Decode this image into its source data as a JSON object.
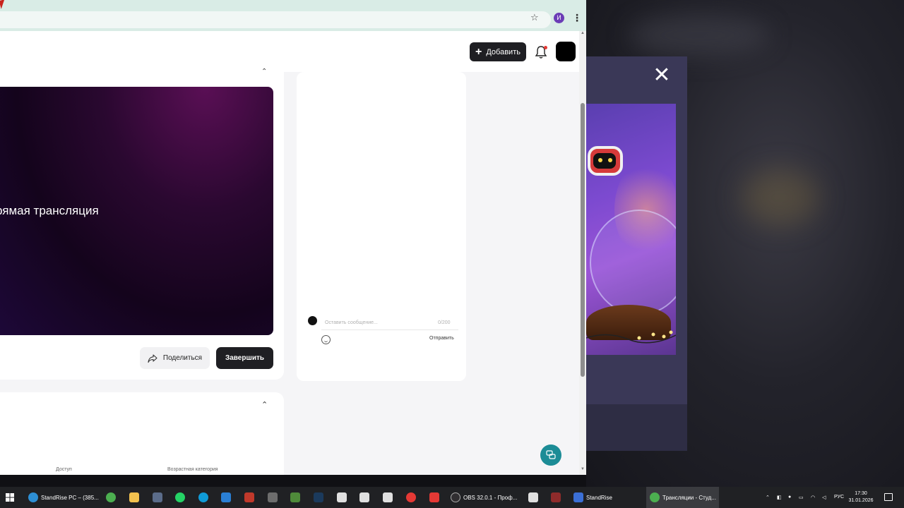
{
  "header": {
    "add_label": "Добавить"
  },
  "stream": {
    "title": "рямая трансляция",
    "share_label": "Поделиться",
    "finish_label": "Завершить"
  },
  "chat": {
    "placeholder": "Оставить сообщение...",
    "counter": "0/200",
    "send_label": "Отправить"
  },
  "settings": {
    "access_label": "Доступ",
    "age_label": "Возрастная категория"
  },
  "browser": {
    "profile_letter": "И"
  },
  "overlay": {
    "close_glyph": "✕"
  },
  "taskbar": {
    "items": [
      {
        "label": "StandRise PC – (385..."
      },
      {
        "label": "OBS 32.0.1 - Проф..."
      },
      {
        "label": "StandRise"
      },
      {
        "label": "Трансляции - Студ..."
      }
    ],
    "lang": "РУС",
    "time": "17:30",
    "date": "31.01.2026"
  },
  "colors": {
    "accent_dark": "#1f1f23",
    "support_teal": "#1c8c96",
    "notification_red": "#e53935"
  },
  "icons": [
    "star-icon",
    "kebab-icon",
    "bell-icon",
    "share-icon",
    "emoji-icon",
    "support-chat-icon",
    "close-icon",
    "chevron-up-icon"
  ]
}
